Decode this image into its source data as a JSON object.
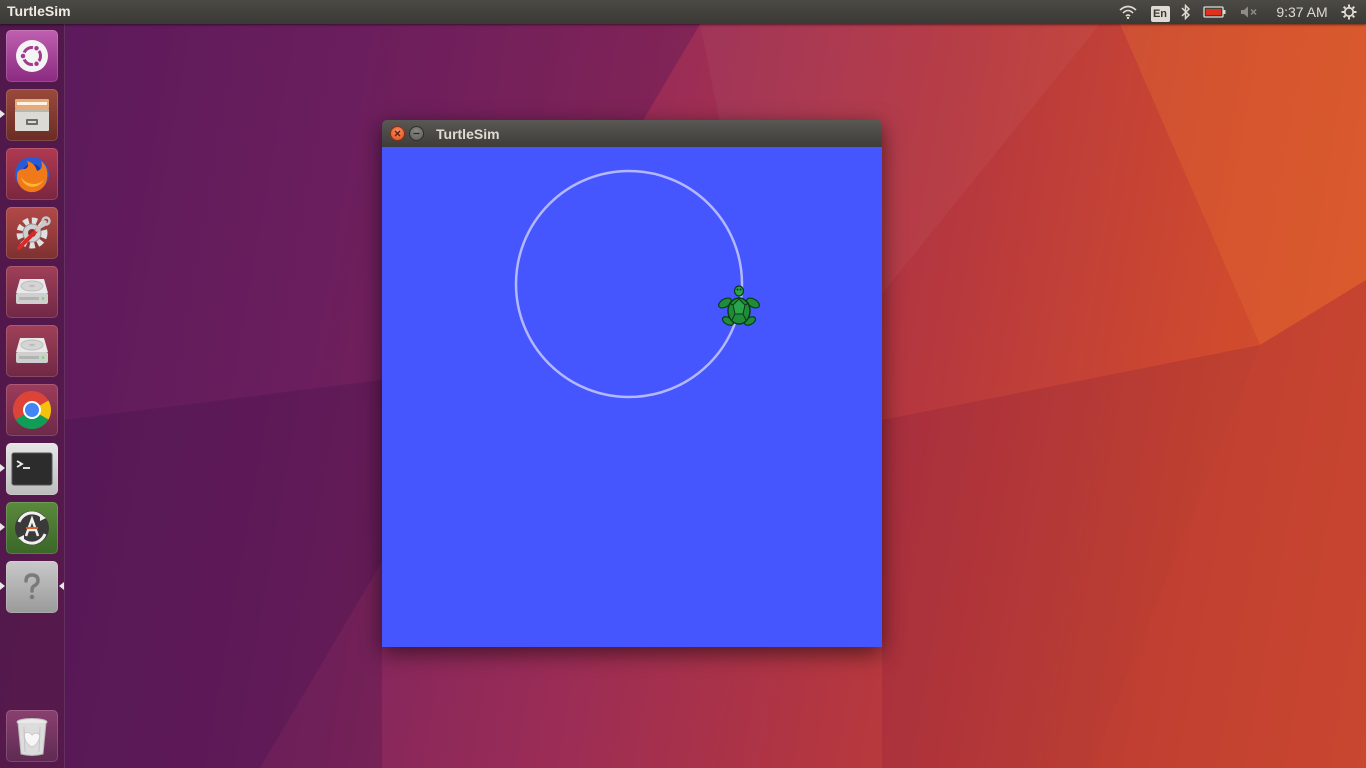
{
  "panel": {
    "app_title": "TurtleSim",
    "keyboard_layout": "En",
    "clock": "9:37 AM",
    "tray_icons": [
      "wifi-icon",
      "keyboard-layout-indicator",
      "bluetooth-icon",
      "battery-icon",
      "volume-muted-icon",
      "session-gear-icon"
    ]
  },
  "launcher": {
    "items": [
      {
        "name": "ubuntu-dash-icon",
        "running": false
      },
      {
        "name": "files-icon",
        "running": true
      },
      {
        "name": "firefox-icon",
        "running": false
      },
      {
        "name": "system-settings-icon",
        "running": false
      },
      {
        "name": "disk-drive-icon",
        "running": false
      },
      {
        "name": "disk-drive-icon",
        "running": false
      },
      {
        "name": "chrome-icon",
        "running": false
      },
      {
        "name": "terminal-icon",
        "running": true
      },
      {
        "name": "software-updater-icon",
        "running": true
      },
      {
        "name": "unknown-app-icon",
        "running": true,
        "focused": true
      },
      {
        "name": "trash-icon",
        "running": false
      }
    ]
  },
  "window": {
    "title": "TurtleSim",
    "background_color": "#4556ff",
    "path_color": "#b3b8ff",
    "turtle_color": "#1f8c3a"
  }
}
